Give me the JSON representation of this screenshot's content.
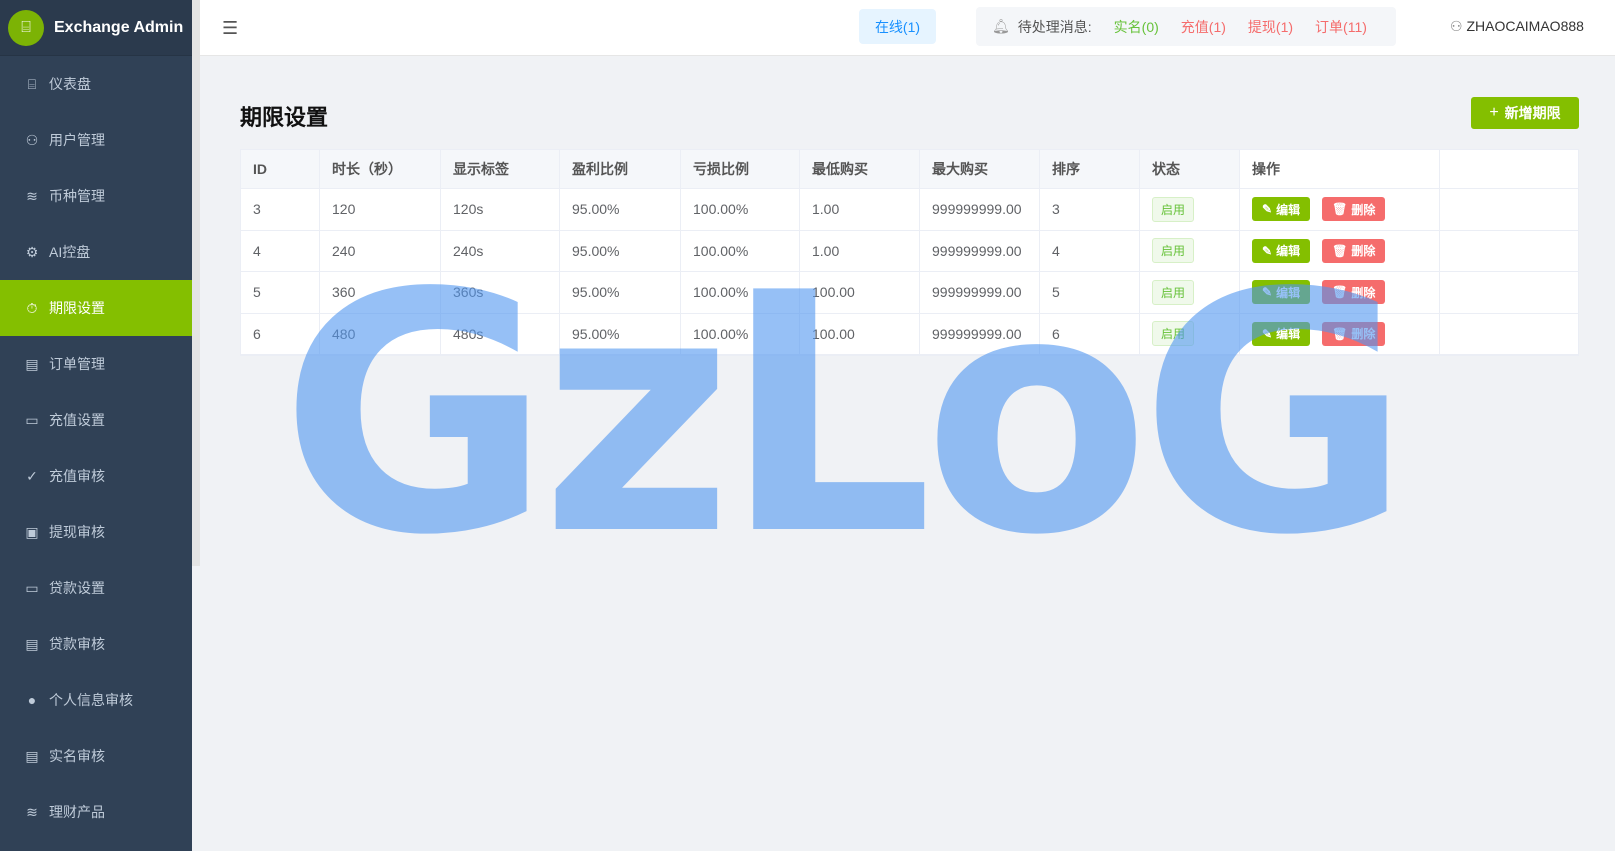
{
  "app": {
    "title": "Exchange Admin"
  },
  "sidebar": {
    "items": [
      {
        "label": "仪表盘",
        "icon": "dashboard-icon",
        "glyph": "⌸"
      },
      {
        "label": "用户管理",
        "icon": "user-icon",
        "glyph": "⚇"
      },
      {
        "label": "币种管理",
        "icon": "database-icon",
        "glyph": "≋"
      },
      {
        "label": "AI控盘",
        "icon": "gear-icon",
        "glyph": "⚙"
      },
      {
        "label": "期限设置",
        "icon": "timer-icon",
        "glyph": "⏱",
        "active": true
      },
      {
        "label": "订单管理",
        "icon": "document-icon",
        "glyph": "▤"
      },
      {
        "label": "充值设置",
        "icon": "wallet-icon",
        "glyph": "▭"
      },
      {
        "label": "充值审核",
        "icon": "check-icon",
        "glyph": "✓"
      },
      {
        "label": "提现审核",
        "icon": "money-icon",
        "glyph": "▣"
      },
      {
        "label": "贷款设置",
        "icon": "wallet-icon",
        "glyph": "▭"
      },
      {
        "label": "贷款审核",
        "icon": "document-icon",
        "glyph": "▤"
      },
      {
        "label": "个人信息审核",
        "icon": "person-icon",
        "glyph": "●"
      },
      {
        "label": "实名审核",
        "icon": "document-check-icon",
        "glyph": "▤"
      },
      {
        "label": "理财产品",
        "icon": "coins-icon",
        "glyph": "≋"
      }
    ]
  },
  "header": {
    "online": "在线(1)",
    "pending_label": "待处理消息:",
    "realname": "实名(0)",
    "recharge": "充值(1)",
    "withdraw": "提现(1)",
    "orders": "订单(11)",
    "username": "ZHAOCAIMAO888"
  },
  "page": {
    "title": "期限设置",
    "add_button": "新增期限"
  },
  "table": {
    "columns": [
      "ID",
      "时长（秒）",
      "显示标签",
      "盈利比例",
      "亏损比例",
      "最低购买",
      "最大购买",
      "排序",
      "状态",
      "操作"
    ],
    "rows": [
      {
        "id": "3",
        "duration": "120",
        "label": "120s",
        "profit": "95.00%",
        "loss": "100.00%",
        "min": "1.00",
        "max": "999999999.00",
        "sort": "3",
        "status": "启用"
      },
      {
        "id": "4",
        "duration": "240",
        "label": "240s",
        "profit": "95.00%",
        "loss": "100.00%",
        "min": "1.00",
        "max": "999999999.00",
        "sort": "4",
        "status": "启用"
      },
      {
        "id": "5",
        "duration": "360",
        "label": "360s",
        "profit": "95.00%",
        "loss": "100.00%",
        "min": "100.00",
        "max": "999999999.00",
        "sort": "5",
        "status": "启用"
      },
      {
        "id": "6",
        "duration": "480",
        "label": "480s",
        "profit": "95.00%",
        "loss": "100.00%",
        "min": "100.00",
        "max": "999999999.00",
        "sort": "6",
        "status": "启用"
      }
    ],
    "edit_label": "编辑",
    "delete_label": "删除"
  },
  "watermark": "GzLoG"
}
